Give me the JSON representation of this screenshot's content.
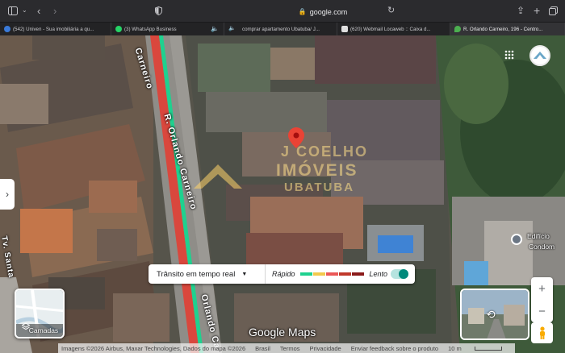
{
  "browser": {
    "url": "google.com",
    "icons": [
      "sidebar-icon",
      "chevron-left-icon",
      "chevron-right-icon",
      "shield-icon",
      "lock-icon",
      "reload-icon",
      "share-icon",
      "new-tab-icon",
      "tab-overview-icon"
    ],
    "tabs": [
      {
        "label": "(542) Univen - Sua imobiliária a qu...",
        "favicon_color": "#3a7ad9"
      },
      {
        "label": "(3) WhatsApp Business",
        "favicon_color": "#25d366"
      },
      {
        "label": "comprar apartamento Ubatuba/ J...",
        "favicon_color": "#8a8a8a"
      },
      {
        "label": "(620) Webmail Locaweb :: Caixa d...",
        "favicon_color": "#e0e0e0"
      },
      {
        "label": "R. Orlando Carneiro, 196 - Centro...",
        "favicon_color": "#4caf50"
      }
    ]
  },
  "map": {
    "street_labels": [
      "R. Orlando Carneiro",
      "Orlando Ca",
      "Carneiro",
      "Tv. Santa"
    ],
    "watermark": {
      "line1": "J COELHO",
      "line2": "IMÓVEIS",
      "line3": "UBATUBA"
    },
    "poi": {
      "line1": "Edifício",
      "line2": "Condom"
    },
    "traffic": {
      "label": "Trânsito em tempo real",
      "fast": "Rápido",
      "slow": "Lento",
      "legend_colors": [
        "#1fd18f",
        "#f2c94c",
        "#eb5757",
        "#c0392b",
        "#8b1a1a"
      ],
      "enabled": true
    },
    "layers_label": "Camadas",
    "logo": "Google Maps",
    "footer": {
      "imagery": "Imagens ©2026 Airbus, Maxar Technologies, Dados do mapa ©2026",
      "country": "Brasil",
      "terms": "Termos",
      "privacy": "Privacidade",
      "feedback": "Enviar feedback sobre o produto",
      "scale": "10 m"
    }
  }
}
